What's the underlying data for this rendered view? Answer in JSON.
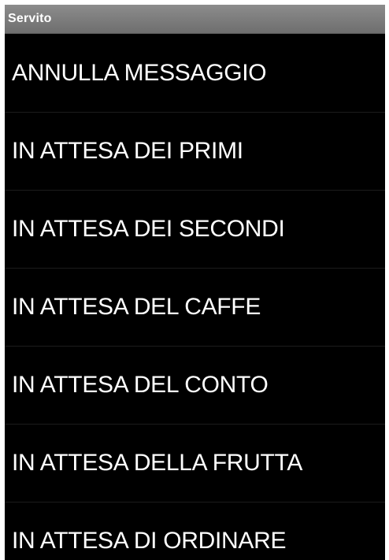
{
  "titlebar": {
    "title": "Servito"
  },
  "list": {
    "items": [
      {
        "label": "ANNULLA MESSAGGIO"
      },
      {
        "label": "IN ATTESA DEI PRIMI"
      },
      {
        "label": "IN ATTESA DEI SECONDI"
      },
      {
        "label": "IN ATTESA DEL CAFFE"
      },
      {
        "label": "IN ATTESA DEL CONTO"
      },
      {
        "label": "IN ATTESA DELLA FRUTTA"
      },
      {
        "label": "IN ATTESA DI ORDINARE"
      }
    ]
  },
  "colors": {
    "background": "#000000",
    "titlebar": "#7d7d7d",
    "text": "#ffffff",
    "divider": "#1c1c1c"
  }
}
